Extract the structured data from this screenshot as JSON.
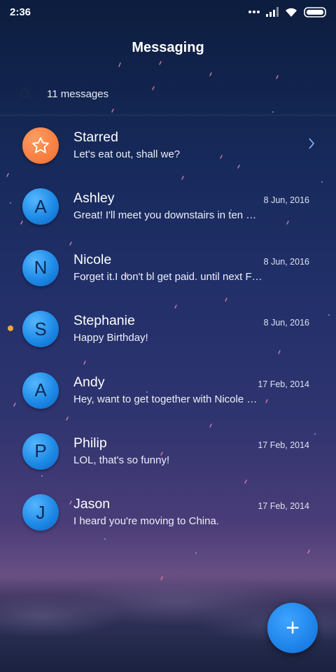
{
  "status_bar": {
    "time": "2:36"
  },
  "header": {
    "title": "Messaging"
  },
  "search": {
    "count_text": "11 messages"
  },
  "conversations": [
    {
      "name": "Starred",
      "preview": "Let's eat out, shall we?",
      "date": "",
      "avatar_letter": "",
      "unread": false
    },
    {
      "name": "Ashley",
      "preview": "Great! I'll meet you downstairs in ten …",
      "date": "8 Jun, 2016",
      "avatar_letter": "A",
      "unread": false
    },
    {
      "name": "Nicole",
      "preview": "Forget it.I don't bl get paid. until next F…",
      "date": "8 Jun, 2016",
      "avatar_letter": "N",
      "unread": false
    },
    {
      "name": "Stephanie",
      "preview": "Happy Birthday!",
      "date": "8 Jun, 2016",
      "avatar_letter": "S",
      "unread": true
    },
    {
      "name": "Andy",
      "preview": "Hey, want to get together with Nicole …",
      "date": "17 Feb, 2014",
      "avatar_letter": "A",
      "unread": false
    },
    {
      "name": "Philip",
      "preview": "LOL, that's so funny!",
      "date": "17 Feb, 2014",
      "avatar_letter": "P",
      "unread": false
    },
    {
      "name": "Jason",
      "preview": "I heard you're moving to China.",
      "date": "17 Feb, 2014",
      "avatar_letter": "J",
      "unread": false
    }
  ],
  "fab": {
    "icon": "plus-icon",
    "label": "+"
  },
  "colors": {
    "accent": "#1a7fe6",
    "starred": "#f77b3c",
    "unread_dot": "#f2a93b"
  }
}
